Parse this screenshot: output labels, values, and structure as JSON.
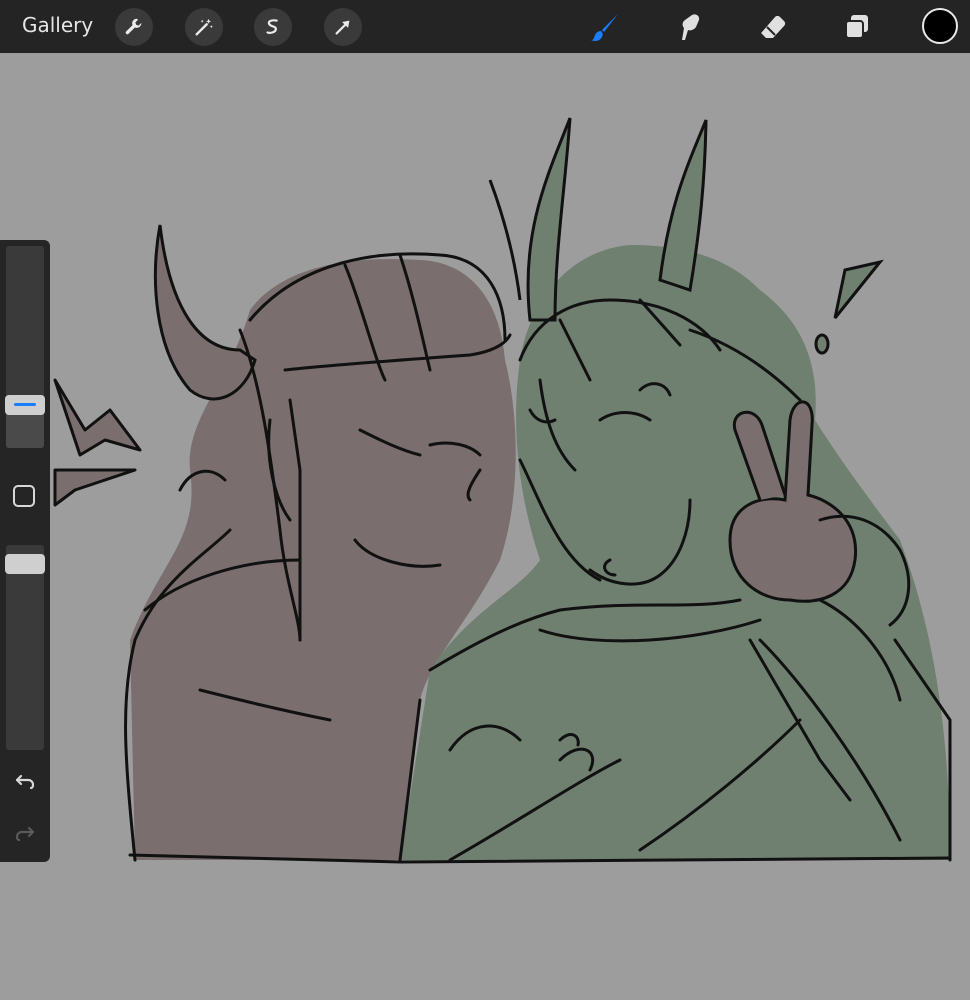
{
  "topbar": {
    "gallery_label": "Gallery",
    "left_tools": [
      "wrench-icon",
      "magic-wand-icon",
      "selection-icon",
      "transform-arrow-icon"
    ],
    "right_tools": [
      "brush-icon",
      "smudge-icon",
      "eraser-icon",
      "layers-icon"
    ],
    "active_tool": "brush-icon",
    "active_color": "#000000",
    "accent_color": "#1a7cff"
  },
  "sidebar": {
    "brush_size_level": 0.18,
    "opacity_level": 0.95,
    "undo_icon": "undo-icon",
    "redo_icon": "redo-icon"
  },
  "canvas": {
    "background": "#9d9d9d",
    "fill_left": "#7a6e6e",
    "fill_right": "#6f8070"
  }
}
